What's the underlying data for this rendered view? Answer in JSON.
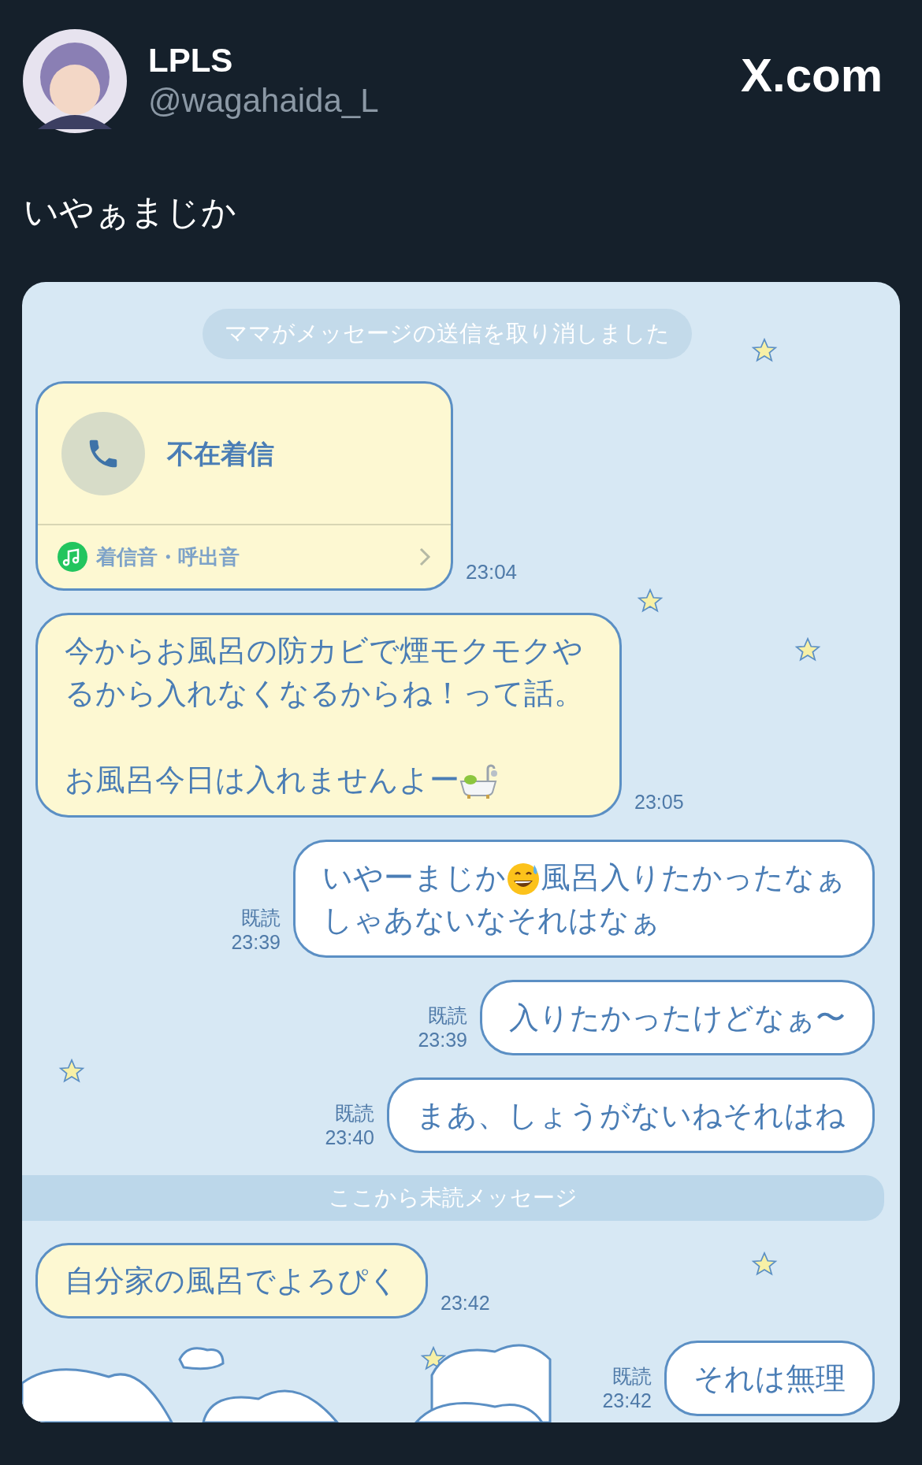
{
  "post": {
    "author": {
      "name": "LPLS",
      "handle": "@wagahaida_L"
    },
    "site": "X.com",
    "text": "いやぁまじか"
  },
  "chat": {
    "items": [
      {
        "kind": "system",
        "text": "ママがメッセージの送信を取り消しました"
      },
      {
        "kind": "call",
        "outgoing": false,
        "title": "不在着信",
        "footer": "着信音・呼出音",
        "time": "23:04"
      },
      {
        "kind": "message",
        "outgoing": false,
        "time": "23:05",
        "content": [
          {
            "kind": "text",
            "text": "今からお風呂の防カビで煙モクモクやるから入れなくなるからね！って話。"
          },
          {
            "kind": "gap"
          },
          {
            "kind": "text",
            "text": "お風呂今日は入れませんよー"
          },
          {
            "kind": "bathtub"
          }
        ]
      },
      {
        "kind": "message",
        "outgoing": true,
        "read": "既読",
        "time": "23:39",
        "content": [
          {
            "kind": "text",
            "text": "いやーまじか"
          },
          {
            "kind": "grin"
          },
          {
            "kind": "text",
            "text": "風呂入りたかったなぁ"
          },
          {
            "kind": "break"
          },
          {
            "kind": "text",
            "text": "しゃあないなそれはなぁ"
          }
        ]
      },
      {
        "kind": "message",
        "outgoing": true,
        "read": "既読",
        "time": "23:39",
        "content": [
          {
            "kind": "text",
            "text": "入りたかったけどなぁ〜"
          }
        ]
      },
      {
        "kind": "message",
        "outgoing": true,
        "read": "既読",
        "time": "23:40",
        "content": [
          {
            "kind": "text",
            "text": "まあ、しょうがないねそれはね"
          }
        ]
      },
      {
        "kind": "divider",
        "text": "ここから未読メッセージ"
      },
      {
        "kind": "message",
        "outgoing": false,
        "time": "23:42",
        "content": [
          {
            "kind": "text",
            "text": "自分家の風呂でよろぴく"
          }
        ]
      },
      {
        "kind": "message",
        "outgoing": true,
        "read": "既読",
        "time": "23:42",
        "content": [
          {
            "kind": "text",
            "text": "それは無理"
          }
        ]
      }
    ]
  }
}
